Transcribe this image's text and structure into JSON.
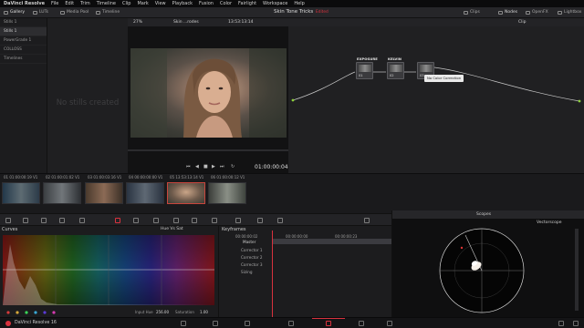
{
  "menubar": {
    "app_name": "DaVinci Resolve",
    "items": [
      "File",
      "Edit",
      "Trim",
      "Timeline",
      "Clip",
      "Mark",
      "View",
      "Playback",
      "Fusion",
      "Color",
      "Fairlight",
      "Workspace",
      "Help"
    ]
  },
  "toolbar": {
    "left": [
      "Gallery",
      "LUTs",
      "Media Pool",
      "Timeline"
    ],
    "project_title": "Skin Tone Tricks",
    "project_status": "Edited",
    "right": [
      "Clips",
      "Nodes",
      "OpenFX",
      "Lightbox"
    ]
  },
  "gallery": {
    "items": [
      "Stills 1",
      "Stills 1",
      "PowerGrade 1",
      "COLLOSS",
      "Timelines"
    ],
    "selected_index": 1,
    "empty_text": "No stills created"
  },
  "viewer": {
    "zoom": "27%",
    "clip_name": "Skin ...rodes",
    "timecode_top": "13:53:13:14",
    "timecode": "01:00:00:04"
  },
  "node_editor": {
    "mode": "Clip",
    "nodes": [
      {
        "label": "EXPOSURE",
        "num": "01"
      },
      {
        "label": "KELVIN",
        "num": "02"
      },
      {
        "label": "",
        "num": "03"
      }
    ],
    "tooltip": "No Color Correction"
  },
  "clips": [
    {
      "num": "01",
      "tc": "01:00:00:19",
      "track": "V1"
    },
    {
      "num": "02",
      "tc": "01:00:01:02",
      "track": "V1"
    },
    {
      "num": "03",
      "tc": "01:00:03:16",
      "track": "V1"
    },
    {
      "num": "04",
      "tc": "00:00:00:00",
      "track": "V1"
    },
    {
      "num": "05",
      "tc": "13:53:13:14",
      "track": "V1"
    },
    {
      "num": "06",
      "tc": "01:00:00:12",
      "track": "V1"
    }
  ],
  "curves": {
    "title": "Curves",
    "mode": "Hue Vs Sat",
    "input_hue_label": "Input Hue",
    "input_hue": "256.00",
    "saturation_label": "Saturation",
    "saturation": "1.00"
  },
  "keyframes": {
    "title": "Keyframes",
    "timecode": "00:00:00:02",
    "tc2": "00:00:00:00",
    "tc3": "00:00:00:23",
    "rows": [
      "Master",
      "Corrector 1",
      "Corrector 2",
      "Corrector 3",
      "Sizing"
    ]
  },
  "scopes": {
    "title": "Scopes",
    "type": "Vectorscope"
  },
  "pagebar": {
    "app_label": "DaVinci Resolve 16"
  },
  "colors": {
    "accent_red": "#d8323e",
    "node_green": "#8ccf3a"
  }
}
